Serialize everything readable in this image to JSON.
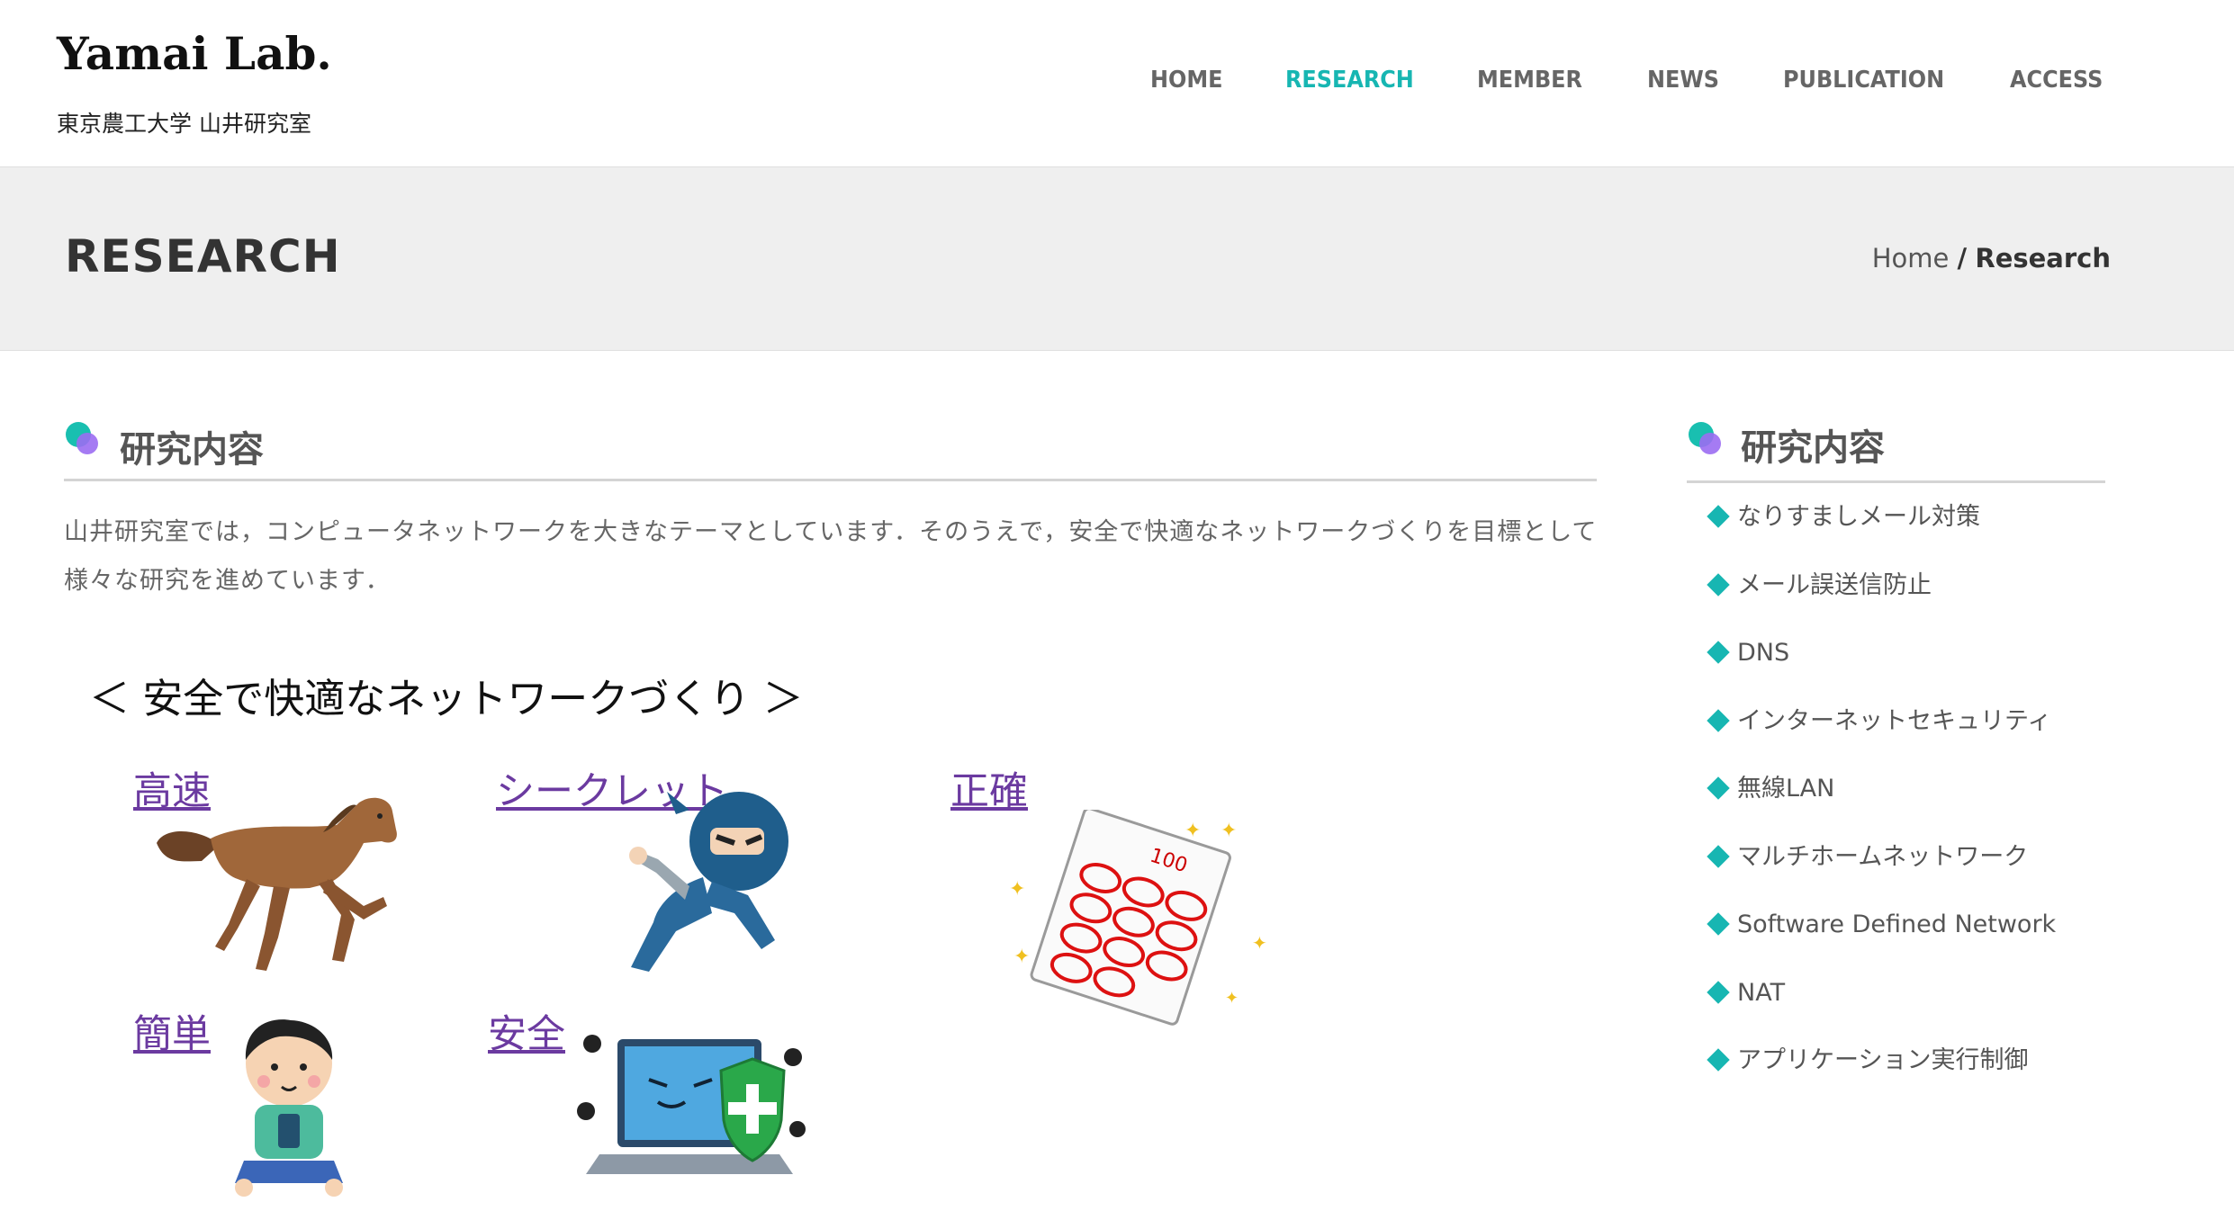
{
  "site": {
    "logo": "Yamai Lab.",
    "tagline": "東京農工大学 山井研究室"
  },
  "nav": {
    "items": [
      {
        "label": "HOME",
        "active": false
      },
      {
        "label": "RESEARCH",
        "active": true
      },
      {
        "label": "MEMBER",
        "active": false
      },
      {
        "label": "NEWS",
        "active": false
      },
      {
        "label": "PUBLICATION",
        "active": false
      },
      {
        "label": "ACCESS",
        "active": false
      }
    ],
    "active_color": "#17b6b2"
  },
  "title_band": {
    "title": "RESEARCH",
    "breadcrumb": {
      "home": "Home",
      "separator": "/",
      "current": "Research"
    }
  },
  "main": {
    "section_title": "研究内容",
    "intro": "山井研究室では，コンピュータネットワークを大きなテーマとしています．そのうえで，安全で快適なネットワークづくりを目標として様々な研究を進めています．",
    "goal_heading": "＜ 安全で快適なネットワークづくり ＞",
    "features": [
      {
        "label": "高速",
        "icon": "horse-icon"
      },
      {
        "label": "シークレット",
        "icon": "ninja-icon"
      },
      {
        "label": "正確",
        "icon": "test-paper-icon"
      },
      {
        "label": "簡単",
        "icon": "boy-smartphone-icon"
      },
      {
        "label": "安全",
        "icon": "secure-laptop-icon"
      }
    ]
  },
  "sidebar": {
    "title": "研究内容",
    "items": [
      "なりすましメール対策",
      "メール誤送信防止",
      "DNS",
      "インターネットセキュリティ",
      "無線LAN",
      "マルチホームネットワーク",
      "Software Defined Network",
      "NAT",
      "アプリケーション実行制御"
    ]
  },
  "colors": {
    "accent": "#17b6b2",
    "link": "#6b3aa0",
    "band": "#efefef"
  }
}
